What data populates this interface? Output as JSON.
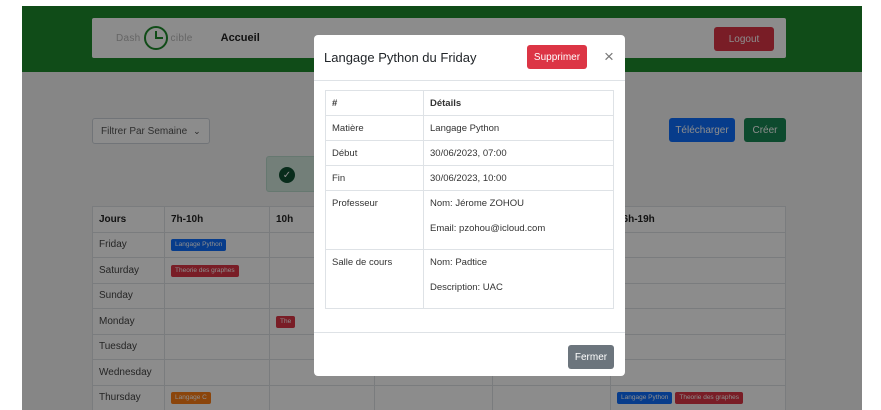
{
  "navbar": {
    "logo_text_left": "Dash",
    "logo_text_right": "cible",
    "accueil": "Accueil",
    "logout": "Logout"
  },
  "toolbar": {
    "filter_value": "Filtrer Par Semaine",
    "telecharger": "Télécharger",
    "creer": "Créer"
  },
  "timetable": {
    "headers": [
      "Jours",
      "7h-10h",
      "10h",
      "",
      "",
      "16h-19h"
    ],
    "rows": [
      {
        "day": "Friday",
        "slots": [
          {
            "label": "Langage Python",
            "color": "#0d6efd"
          },
          null,
          null,
          null,
          null
        ]
      },
      {
        "day": "Saturday",
        "slots": [
          {
            "label": "Theorie des graphes",
            "color": "#dc3545"
          },
          null,
          null,
          null,
          null
        ]
      },
      {
        "day": "Sunday",
        "slots": [
          null,
          null,
          null,
          null,
          null
        ]
      },
      {
        "day": "Monday",
        "slots": [
          null,
          {
            "label": "The",
            "color": "#dc3545"
          },
          null,
          null,
          null
        ]
      },
      {
        "day": "Tuesday",
        "slots": [
          null,
          null,
          null,
          null,
          null
        ]
      },
      {
        "day": "Wednesday",
        "slots": [
          null,
          null,
          null,
          null,
          null
        ]
      },
      {
        "day": "Thursday",
        "slots": [
          {
            "label": "Langage C",
            "color": "#fd7e14"
          },
          null,
          null,
          null,
          [
            {
              "label": "Langage Python",
              "color": "#0d6efd"
            },
            {
              "label": "Theorie des graphes",
              "color": "#dc3545"
            }
          ]
        ]
      }
    ]
  },
  "modal": {
    "title": "Langage Python du Friday",
    "supprimer": "Supprimer",
    "close_glyph": "×",
    "table": {
      "col_hash": "#",
      "col_details": "Détails",
      "matiere_label": "Matière",
      "matiere_value": "Langage Python",
      "debut_label": "Début",
      "debut_value": "30/06/2023, 07:00",
      "fin_label": "Fin",
      "fin_value": "30/06/2023, 10:00",
      "professeur_label": "Professeur",
      "professeur_nom": "Nom: Jérome ZOHOU",
      "professeur_email": "Email: pzohou@icloud.com",
      "salle_label": "Salle de cours",
      "salle_nom": "Nom: Padtice",
      "salle_description": "Description: UAC"
    },
    "fermer": "Fermer"
  }
}
